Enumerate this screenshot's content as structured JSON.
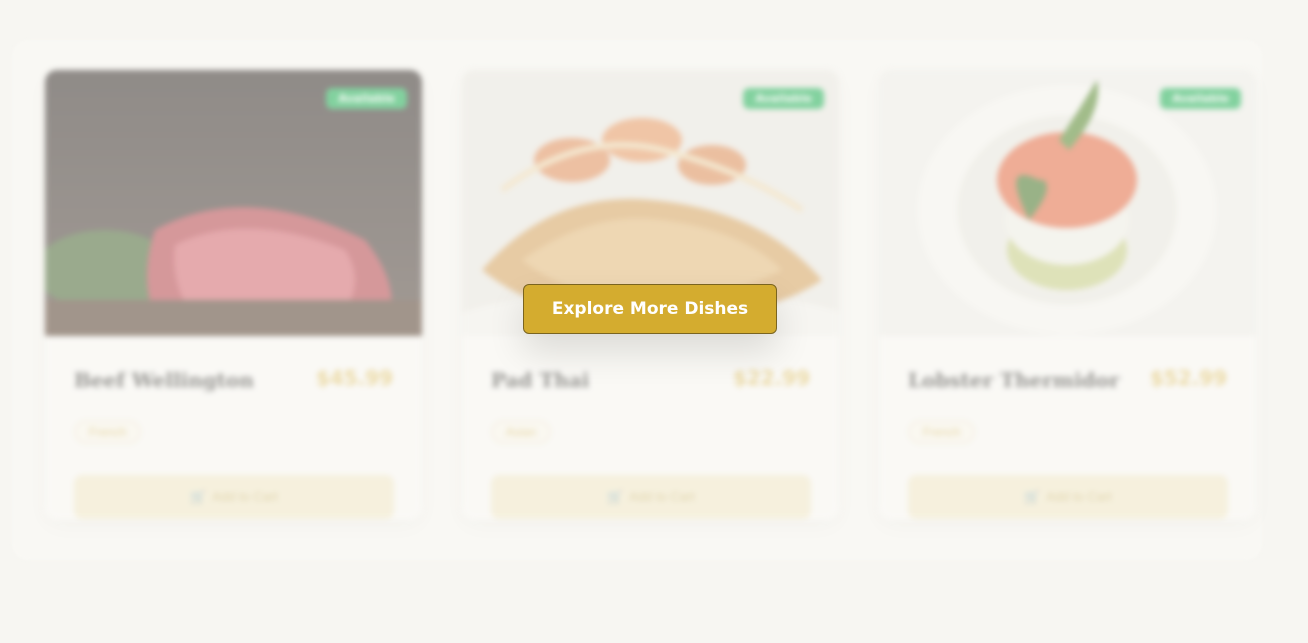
{
  "cta": {
    "label": "Explore More Dishes"
  },
  "dishes": [
    {
      "name": "Beef Wellington",
      "price": "$45.99",
      "cuisine": "French",
      "status": "Available",
      "add_label": "Add to Cart"
    },
    {
      "name": "Pad Thai",
      "price": "$22.99",
      "cuisine": "Asian",
      "status": "Available",
      "add_label": "Add to Cart"
    },
    {
      "name": "Lobster Thermidor",
      "price": "$52.99",
      "cuisine": "French",
      "status": "Available",
      "add_label": "Add to Cart"
    }
  ],
  "colors": {
    "accent": "#d4ac2f",
    "status_available": "#22b35a",
    "background": "#f7f6f2"
  },
  "icons": {
    "cart": "cart-icon"
  }
}
